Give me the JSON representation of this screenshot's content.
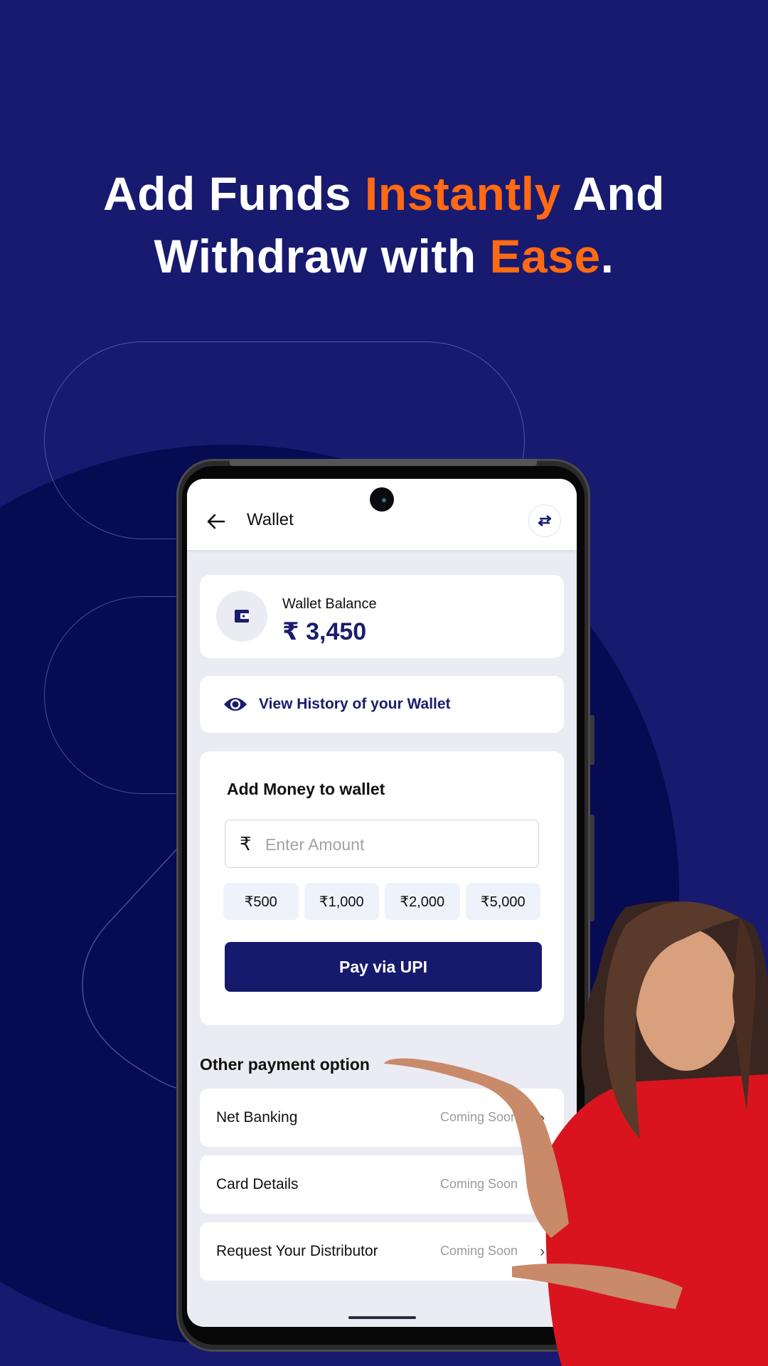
{
  "headline": {
    "line1_part1": "Add Funds ",
    "line1_accent": "Instantly",
    "line1_part2": " And",
    "line2_part1": "Withdraw with ",
    "line2_accent": "Ease",
    "line2_part2": "."
  },
  "colors": {
    "background": "#171a6f",
    "accent": "#ff6a13",
    "primary": "#161a6d"
  },
  "app": {
    "title": "Wallet",
    "back_icon": "arrow-left-icon",
    "swap_icon": "swap-arrows-icon",
    "balance": {
      "label": "Wallet Balance",
      "value": "₹ 3,450",
      "icon": "wallet-icon"
    },
    "history_link": {
      "label": "View History of your Wallet",
      "icon": "eye-icon"
    },
    "add_money": {
      "title": "Add Money to wallet",
      "currency_symbol": "₹",
      "input_value": "",
      "input_placeholder": "Enter Amount",
      "quick_amounts": [
        "₹500",
        "₹1,000",
        "₹2,000",
        "₹5,000"
      ],
      "pay_button": "Pay via UPI"
    },
    "other_options": {
      "title": "Other payment option",
      "items": [
        {
          "label": "Net Banking",
          "status": "Coming Soon"
        },
        {
          "label": "Card Details",
          "status": "Coming Soon"
        },
        {
          "label": "Request Your Distributor",
          "status": "Coming Soon"
        }
      ]
    }
  }
}
